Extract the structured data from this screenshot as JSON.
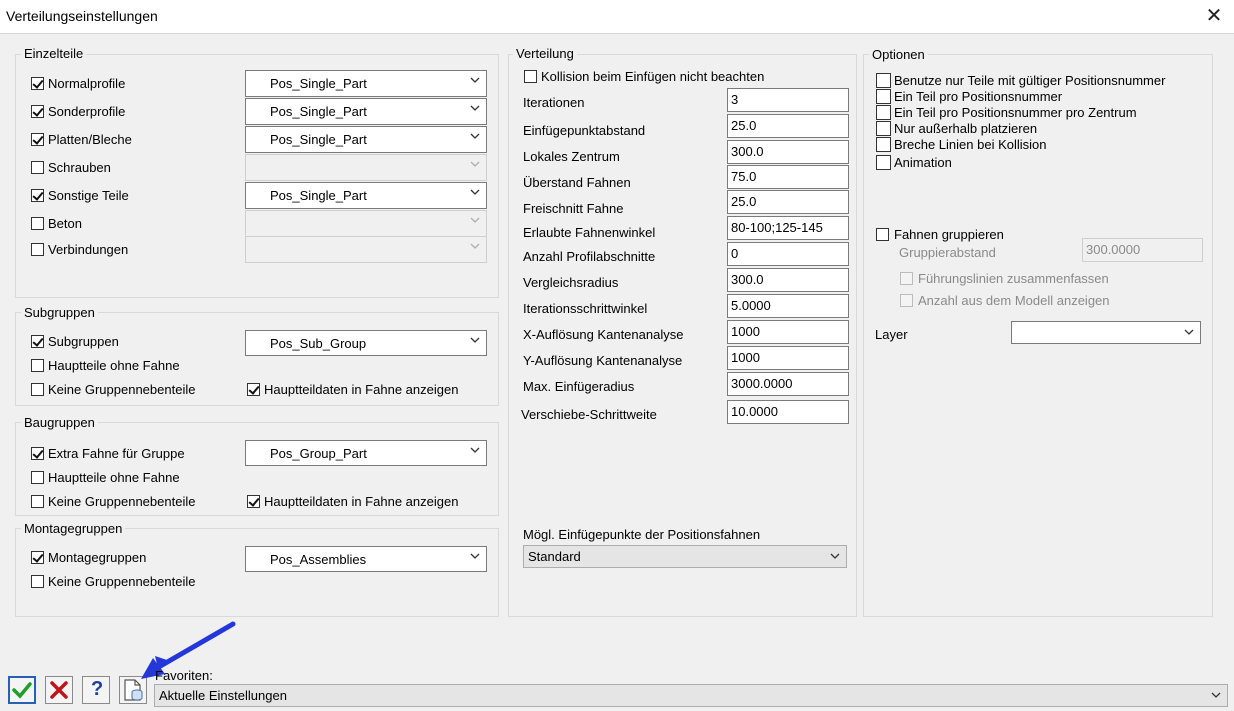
{
  "window": {
    "title": "Verteilungseinstellungen",
    "close_glyph": "✕"
  },
  "einzelteile": {
    "title": "Einzelteile",
    "rows": [
      {
        "label": "Normalprofile",
        "checked": true,
        "select": "Pos_Single_Part"
      },
      {
        "label": "Sonderprofile",
        "checked": true,
        "select": "Pos_Single_Part"
      },
      {
        "label": "Platten/Bleche",
        "checked": true,
        "select": "Pos_Single_Part"
      },
      {
        "label": "Schrauben",
        "checked": false,
        "select": ""
      },
      {
        "label": "Sonstige Teile",
        "checked": true,
        "select": "Pos_Single_Part"
      },
      {
        "label": "Beton",
        "checked": false,
        "select": ""
      },
      {
        "label": "Verbindungen",
        "checked": false,
        "select": ""
      }
    ]
  },
  "subgruppen": {
    "title": "Subgruppen",
    "main_label": "Subgruppen",
    "main_select": "Pos_Sub_Group",
    "ohne_fahne": "Hauptteile ohne Fahne",
    "keine_neben": "Keine Gruppennebenteile",
    "hauptdaten": "Hauptteildaten in Fahne anzeigen"
  },
  "baugruppen": {
    "title": "Baugruppen",
    "main_label": "Extra Fahne für Gruppe",
    "main_select": "Pos_Group_Part",
    "ohne_fahne": "Hauptteile ohne Fahne",
    "keine_neben": "Keine Gruppennebenteile",
    "hauptdaten": "Hauptteildaten in Fahne anzeigen"
  },
  "montagegruppen": {
    "title": "Montagegruppen",
    "main_label": "Montagegruppen",
    "main_select": "Pos_Assemblies",
    "keine_neben": "Keine Gruppennebenteile"
  },
  "verteilung": {
    "title": "Verteilung",
    "kollision": "Kollision beim Einfügen nicht beachten",
    "fields": [
      {
        "label": "Iterationen",
        "value": "3"
      },
      {
        "label": "Einfügepunktabstand",
        "value": "25.0"
      },
      {
        "label": "Lokales Zentrum",
        "value": "300.0"
      },
      {
        "label": "Überstand Fahnen",
        "value": "75.0"
      },
      {
        "label": "Freischnitt Fahne",
        "value": "25.0"
      },
      {
        "label": "Erlaubte Fahnenwinkel",
        "value": "80-100;125-145"
      },
      {
        "label": "Anzahl Profilabschnitte",
        "value": "0"
      },
      {
        "label": "Vergleichsradius",
        "value": "300.0"
      },
      {
        "label": "Iterationsschrittwinkel",
        "value": "5.0000"
      },
      {
        "label": "X-Auflösung Kantenanalyse",
        "value": "1000"
      },
      {
        "label": "Y-Auflösung Kantenanalyse",
        "value": "1000"
      },
      {
        "label": "Max. Einfügeradius",
        "value": "3000.0000"
      },
      {
        "label": "Verschiebe-Schrittweite",
        "value": "10.0000"
      }
    ],
    "einfuege_label": "Mögl. Einfügepunkte der Positionsfahnen",
    "einfuege_value": "Standard"
  },
  "optionen": {
    "title": "Optionen",
    "items": [
      "Benutze nur Teile mit gültiger Positionsnummer",
      "Ein Teil pro Positionsnummer",
      "Ein Teil pro Positionsnummer pro Zentrum",
      "Nur außerhalb platzieren",
      "Breche Linien bei Kollision",
      "Animation"
    ],
    "gruppieren": "Fahnen gruppieren",
    "gruppierabstand_label": "Gruppierabstand",
    "gruppierabstand_value": "300.0000",
    "fuehrung": "Führungslinien zusammenfassen",
    "anzahl": "Anzahl aus dem Modell anzeigen",
    "layer_label": "Layer",
    "layer_value": ""
  },
  "footer": {
    "favoriten_label": "Favoriten:",
    "favoriten_value": "Aktuelle Einstellungen",
    "help_glyph": "?"
  },
  "colors": {
    "ok_green": "#1f9e2a",
    "cancel_red": "#c0141c",
    "help_blue": "#1b3f9a",
    "arrow_blue": "#2437d8"
  }
}
